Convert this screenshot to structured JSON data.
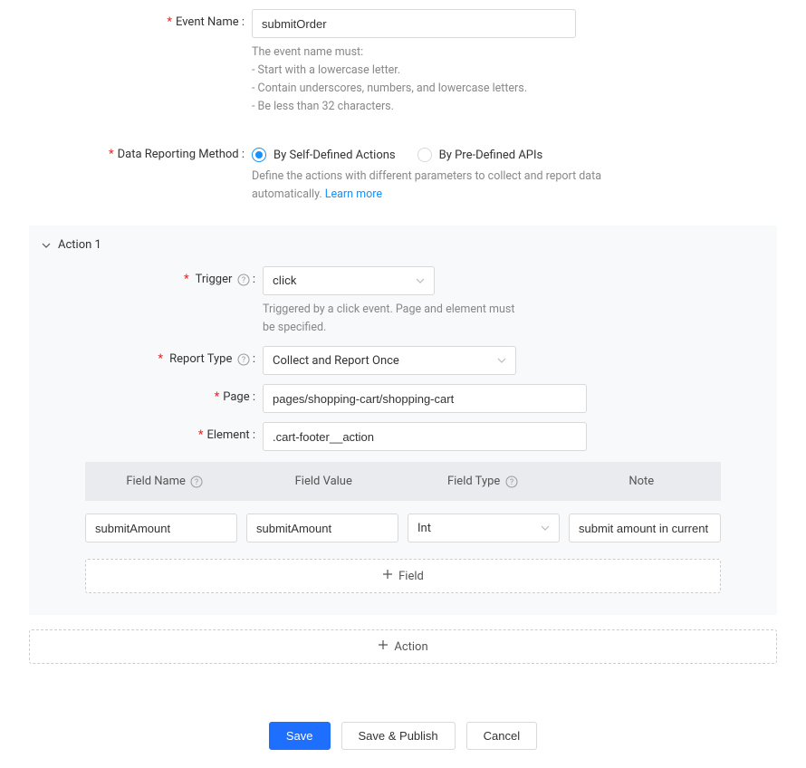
{
  "event_name": {
    "label": "Event Name :",
    "value": "submitOrder",
    "help": [
      "The event name must:",
      "- Start with a lowercase letter.",
      "- Contain underscores, numbers, and lowercase letters.",
      "- Be less than 32 characters."
    ]
  },
  "reporting_method": {
    "label": "Data Reporting Method :",
    "options": [
      "By Self-Defined Actions",
      "By Pre-Defined APIs"
    ],
    "selected": 0,
    "help_text": "Define the actions with different parameters to collect and report data automatically. ",
    "help_link": "Learn more"
  },
  "action": {
    "title": "Action 1",
    "trigger": {
      "label": "Trigger",
      "value": "click",
      "help": "Triggered by a click event. Page and element must be specified."
    },
    "report_type": {
      "label": "Report Type",
      "value": "Collect and Report Once"
    },
    "page": {
      "label": "Page :",
      "value": "pages/shopping-cart/shopping-cart"
    },
    "element": {
      "label": "Element :",
      "value": ".cart-footer__action"
    },
    "field_table": {
      "headers": [
        "Field Name",
        "Field Value",
        "Field Type",
        "Note"
      ],
      "row": {
        "name": "submitAmount",
        "value": "submitAmount",
        "type": "Int",
        "note": "submit amount in current sh"
      }
    },
    "add_field_label": "Field"
  },
  "add_action_label": "Action",
  "footer": {
    "save": "Save",
    "save_publish": "Save & Publish",
    "cancel": "Cancel"
  }
}
